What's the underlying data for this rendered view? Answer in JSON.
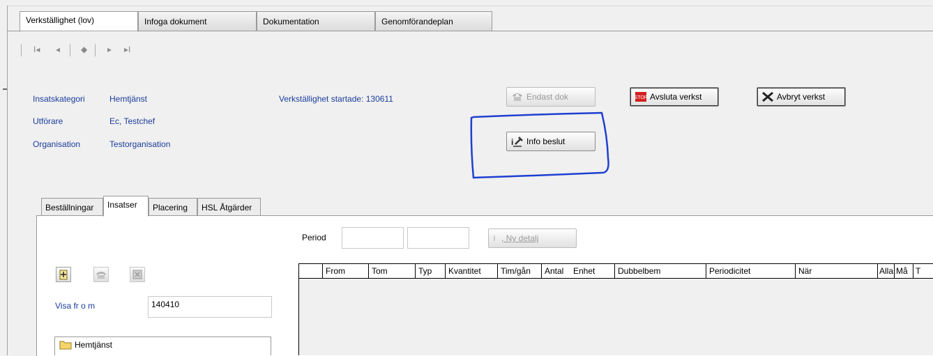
{
  "tabs": [
    {
      "label": "Verkställighet (lov)",
      "active": true
    },
    {
      "label": "Infoga dokument",
      "active": false
    },
    {
      "label": "Dokumentation",
      "active": false
    },
    {
      "label": "Genomförandeplan",
      "active": false
    }
  ],
  "nav": {
    "first": "I◂",
    "prev": "◂",
    "current": "◆",
    "next": "▸",
    "last": "▸I"
  },
  "info": {
    "insatskategori_label": "Insatskategori",
    "insatskategori_value": "Hemtjänst",
    "utforare_label": "Utförare",
    "utforare_value": "Ec, Testchef",
    "organisation_label": "Organisation",
    "organisation_value": "Testorganisation",
    "started": "Verkställighet startade: 130611"
  },
  "buttons": {
    "endast_dok": "Endast dok",
    "avsluta": "Avsluta verkst",
    "avbryt": "Avbryt verkst",
    "info_beslut": "Info beslut",
    "ny_detalj": ", Ny detalj"
  },
  "subtabs": [
    {
      "label": "Beställningar",
      "active": false
    },
    {
      "label": "Insatser",
      "active": true
    },
    {
      "label": "Placering",
      "active": false
    },
    {
      "label": "HSL Åtgärder",
      "active": false
    }
  ],
  "period": {
    "label": "Period",
    "from": "",
    "to": ""
  },
  "visa": {
    "label": "Visa fr o m",
    "value": "140410"
  },
  "grid_columns": [
    "",
    "From",
    "Tom",
    "Typ",
    "Kvantitet",
    "Tim/gån",
    "Antal",
    "Enhet",
    "Dubbelbem",
    "Periodicitet",
    "När",
    "Alla",
    "Må",
    "T"
  ],
  "tree": {
    "item": "Hemtjänst"
  },
  "colors": {
    "label_blue": "#1a3d9a",
    "annotation_blue": "#1f3fd0",
    "stop_red": "#d42020"
  },
  "icons": [
    "phone-icon",
    "stop-sign-icon",
    "cancel-tools-icon",
    "info-gavel-icon",
    "add-icon",
    "copy-icon",
    "delete-icon",
    "folder-icon"
  ]
}
